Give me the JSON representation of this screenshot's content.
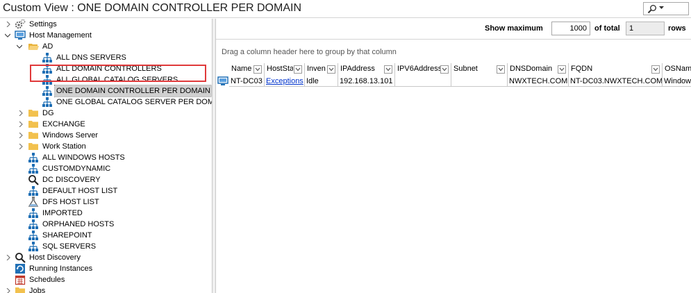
{
  "window": {
    "title": "Custom View : ONE DOMAIN CONTROLLER PER DOMAIN"
  },
  "tree": {
    "settings": "Settings",
    "host_management": "Host Management",
    "ad": "AD",
    "ad_children": [
      "ALL DNS SERVERS",
      "ALL DOMAIN CONTROLLERS",
      "ALL GLOBAL CATALOG SERVERS",
      "ONE DOMAIN CONTROLLER PER DOMAIN",
      "ONE GLOBAL CATALOG SERVER PER DOMAIN"
    ],
    "folders": [
      "DG",
      "EXCHANGE",
      "Windows Server",
      "Work Station"
    ],
    "views": [
      "ALL WINDOWS HOSTS",
      "CUSTOMDYNAMIC",
      "DC DISCOVERY",
      "DEFAULT HOST LIST",
      "DFS HOST LIST",
      "IMPORTED",
      "ORPHANED HOSTS",
      "SHAREPOINT",
      "SQL SERVERS"
    ],
    "bottom": [
      "Host Discovery",
      "Running Instances",
      "Schedules",
      "Jobs"
    ]
  },
  "toolbar": {
    "show_maximum_label": "Show maximum",
    "show_maximum_value": "1000",
    "of_total_label": "of total",
    "total_value": "1",
    "rows_label": "rows"
  },
  "grid": {
    "group_hint": "Drag a column header here to group by that column",
    "columns": [
      "Name",
      "HostSta",
      "Inven",
      "IPAddress",
      "IPV6Address",
      "Subnet",
      "DNSDomain",
      "FQDN",
      "OSNam"
    ],
    "rows": [
      {
        "name": "NT-DC03",
        "host_status": "Exceptions",
        "inventory": "Idle",
        "ip": "192.168.13.101",
        "ipv6": "",
        "subnet": "",
        "dns_domain": "NWXTECH.COM",
        "fqdn": "NT-DC03.NWXTECH.COM",
        "os": "Window"
      }
    ]
  },
  "colors": {
    "highlight": "#e0393a",
    "link": "#0033cc",
    "folder": "#f2c14e",
    "tree_icon": "#1f6fb5"
  }
}
